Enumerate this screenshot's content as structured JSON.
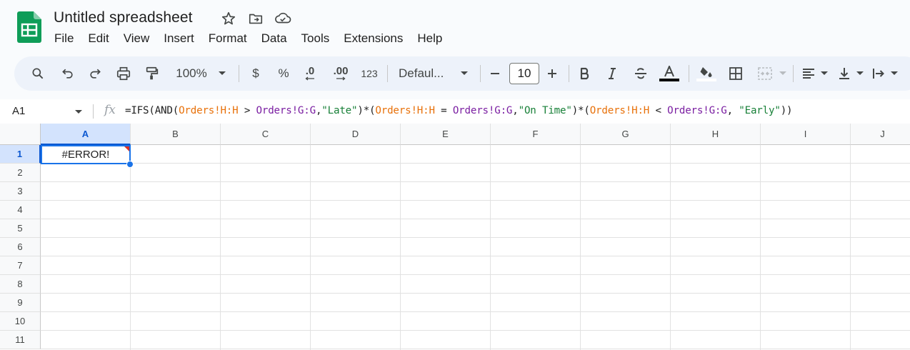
{
  "app": {
    "title": "Untitled spreadsheet",
    "accent": "#0b57d0",
    "logo_color": "#0f9d58"
  },
  "menu": [
    "File",
    "Edit",
    "View",
    "Insert",
    "Format",
    "Data",
    "Tools",
    "Extensions",
    "Help"
  ],
  "toolbar": {
    "zoom": "100%",
    "currency": "$",
    "percent": "%",
    "decrease_decimal": ".0",
    "increase_decimal": ".00",
    "number_format": "123",
    "font": "Defaul...",
    "font_size": "10",
    "icons": [
      "search-icon",
      "undo-icon",
      "redo-icon",
      "print-icon",
      "paint-format-icon",
      "bold-icon",
      "italic-icon",
      "strikethrough-icon",
      "text-color-icon",
      "fill-color-icon",
      "borders-icon",
      "merge-cells-icon",
      "align-left-icon",
      "vertical-align-icon",
      "text-wrap-icon"
    ]
  },
  "formula_bar": {
    "name_box": "A1",
    "fx": "fx",
    "tokens": [
      {
        "t": "=IFS(AND(",
        "c": "plain"
      },
      {
        "t": "Orders!H:H",
        "c": "orange"
      },
      {
        "t": " > ",
        "c": "plain"
      },
      {
        "t": "Orders!G:G",
        "c": "purple"
      },
      {
        "t": ",",
        "c": "plain"
      },
      {
        "t": "\"Late\"",
        "c": "green"
      },
      {
        "t": ")*(",
        "c": "plain"
      },
      {
        "t": "Orders!H:H",
        "c": "orange"
      },
      {
        "t": " = ",
        "c": "plain"
      },
      {
        "t": "Orders!G:G",
        "c": "purple"
      },
      {
        "t": ",",
        "c": "plain"
      },
      {
        "t": "\"On Time\"",
        "c": "green"
      },
      {
        "t": ")*(",
        "c": "plain"
      },
      {
        "t": "Orders!H:H",
        "c": "orange"
      },
      {
        "t": " < ",
        "c": "plain"
      },
      {
        "t": "Orders!G:G",
        "c": "purple"
      },
      {
        "t": ", ",
        "c": "plain"
      },
      {
        "t": "\"Early\"",
        "c": "green"
      },
      {
        "t": "))",
        "c": "plain"
      }
    ]
  },
  "grid": {
    "columns": [
      "A",
      "B",
      "C",
      "D",
      "E",
      "F",
      "G",
      "H",
      "I",
      "J"
    ],
    "rows": [
      "1",
      "2",
      "3",
      "4",
      "5",
      "6",
      "7",
      "8",
      "9",
      "10",
      "11"
    ],
    "selected_column": "A",
    "selected_row": "1",
    "a1_value": "#ERROR!"
  }
}
